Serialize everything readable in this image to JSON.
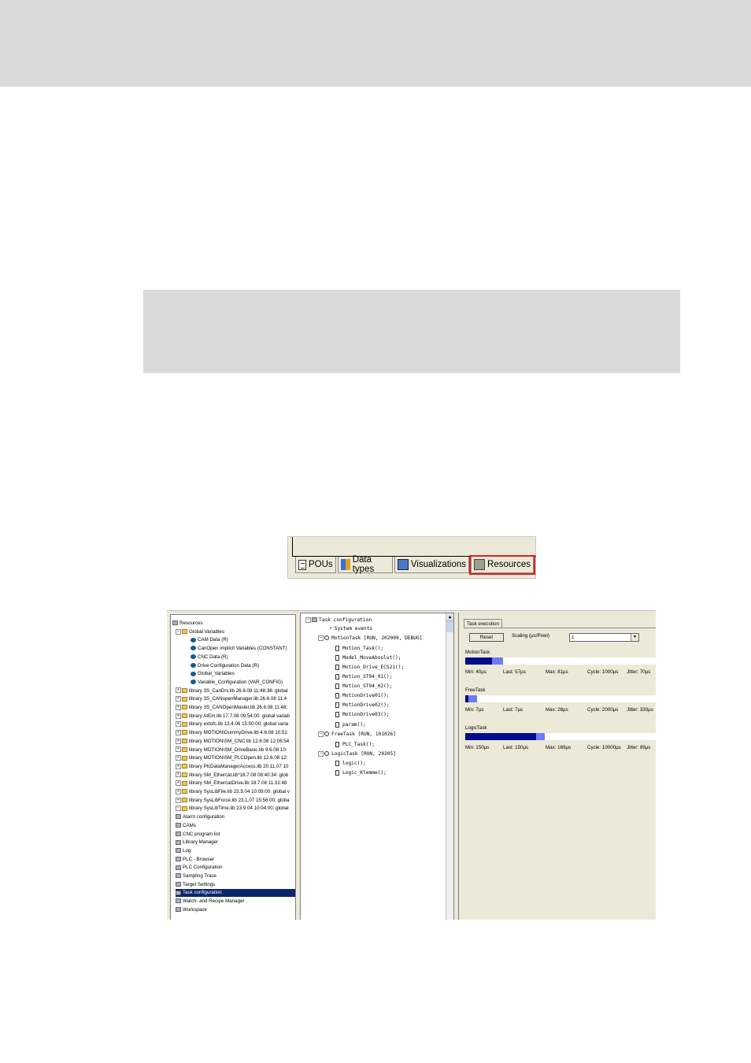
{
  "tabstrip": {
    "tabs": [
      {
        "label": "POUs",
        "icon": "document-icon"
      },
      {
        "label": "Data types",
        "icon": "data-types-icon"
      },
      {
        "label": "Visualizations",
        "icon": "visualization-icon"
      },
      {
        "label": "Resources",
        "icon": "resources-icon",
        "selected": true,
        "highlight_color": "#e02020"
      }
    ]
  },
  "left_tree": {
    "items": [
      {
        "label": "Resources",
        "icon": "resources-icon"
      },
      {
        "label": "Global Variables",
        "icon": "folder-icon"
      },
      {
        "label": "CAM Data (R)",
        "icon": "globe-icon"
      },
      {
        "label": "CanOpen implicit Variables (CONSTANT)",
        "icon": "globe-icon"
      },
      {
        "label": "CNC Data (R)",
        "icon": "globe-icon"
      },
      {
        "label": "Drive Configuration Data (R)",
        "icon": "globe-icon"
      },
      {
        "label": "Global_Variables",
        "icon": "globe-icon"
      },
      {
        "label": "Variable_Configuration (VAR_CONFIG)",
        "icon": "globe-icon"
      },
      {
        "label": "library 3S_CanDrv.lib 26.6.08 11:48:36: global",
        "icon": "folder-icon"
      },
      {
        "label": "library 3S_CANopenManager.lib 26.6.08 11:4",
        "icon": "folder-icon"
      },
      {
        "label": "library 3S_CANOpenMaster.lib 26.6.08 11:48:",
        "icon": "folder-icon"
      },
      {
        "label": "library AtEm.lib 17.7.08 09:54:00: global variab",
        "icon": "folder-icon"
      },
      {
        "label": "library extofc.lib 13.4.06 15:50:00: global varia",
        "icon": "folder-icon"
      },
      {
        "label": "library MOTION\\DummyDrive.lib 4.6.08 10:51:",
        "icon": "folder-icon"
      },
      {
        "label": "library MOTION\\SM_CNC.lib 12.6.08 12:06:54",
        "icon": "folder-icon"
      },
      {
        "label": "library MOTION\\SM_DriveBasic.lib 9.6.08 10:",
        "icon": "folder-icon"
      },
      {
        "label": "library MOTION\\SM_PLCOpen.lib 12.6.08 12:",
        "icon": "folder-icon"
      },
      {
        "label": "library PlcDataManagerAccess.lib 20.11.07 10",
        "icon": "folder-icon"
      },
      {
        "label": "library SM_Ethercat.lib*18.7.08 08:40:34: glob",
        "icon": "folder-icon"
      },
      {
        "label": "library SM_EthercatDrive.lib 18.7.08 11:31:48",
        "icon": "folder-icon"
      },
      {
        "label": "library SysLibFile.lib 23.9.04 10:09:00: global v",
        "icon": "folder-icon"
      },
      {
        "label": "library SysLibForce.lib 23.1.07 15:56:00: globa",
        "icon": "folder-icon"
      },
      {
        "label": "library SysLibTime.lib 23.9.04 10:04:00: global",
        "icon": "folder-icon"
      },
      {
        "label": "Alarm configuration",
        "icon": "alarm-icon"
      },
      {
        "label": "CAMs",
        "icon": "cam-icon"
      },
      {
        "label": "CNC program list",
        "icon": "cnc-icon"
      },
      {
        "label": "Library Manager",
        "icon": "library-icon"
      },
      {
        "label": "Log",
        "icon": "log-icon"
      },
      {
        "label": "PLC - Browser",
        "icon": "browser-icon"
      },
      {
        "label": "PLC Configuration",
        "icon": "plc-config-icon"
      },
      {
        "label": "Sampling Trace",
        "icon": "trace-icon"
      },
      {
        "label": "Target Settings",
        "icon": "target-icon"
      },
      {
        "label": "Task configuration",
        "icon": "task-config-icon",
        "selected": true
      },
      {
        "label": "Watch- and Recipe Manager",
        "icon": "watch-icon"
      },
      {
        "label": "Workspace",
        "icon": "workspace-icon"
      }
    ]
  },
  "mid_tree": {
    "items": [
      {
        "label": "Task configuration",
        "icon": "task-config-icon"
      },
      {
        "label": "System events",
        "icon": "lightning-icon"
      },
      {
        "label": "MotionTask [RUN, 202009, DEBUG]",
        "icon": "clock-icon"
      },
      {
        "label": "Motion_Task();",
        "icon": "page-icon"
      },
      {
        "label": "Model_MoveAbsolut();",
        "icon": "page-icon"
      },
      {
        "label": "Motion_Drive_ECS21();",
        "icon": "page-icon"
      },
      {
        "label": "Motion_ST94_01();",
        "icon": "page-icon"
      },
      {
        "label": "Motion_ST94_02();",
        "icon": "page-icon"
      },
      {
        "label": "MotionDrive01();",
        "icon": "page-icon"
      },
      {
        "label": "MotionDrive02();",
        "icon": "page-icon"
      },
      {
        "label": "MotionDrive03();",
        "icon": "page-icon"
      },
      {
        "label": "param();",
        "icon": "page-icon"
      },
      {
        "label": "FreeTask [RUN, 101026]",
        "icon": "clock-icon"
      },
      {
        "label": "PLC_Task();",
        "icon": "page-icon"
      },
      {
        "label": "LogicTask [RUN, 20205]",
        "icon": "clock-icon"
      },
      {
        "label": "logic();",
        "icon": "page-icon"
      },
      {
        "label": "Logic_Klemme();",
        "icon": "page-icon"
      }
    ]
  },
  "task_execution": {
    "tab_label": "Task execution",
    "reset_label": "Reset",
    "scaling_label": "Scaling (µs/Pixel)",
    "scaling_value": "1",
    "dropdown_arrow": "▼",
    "colors": {
      "bar_min": "#000c8c",
      "bar_extra": "#6d7cf2",
      "track": "#ffffff"
    },
    "tasks": [
      {
        "name": "MotionTask",
        "min": "Min: 40µs",
        "last": "Last: 57µs",
        "max": "Max: 81µs",
        "cycle": "Cycle: 1000µs",
        "jitter": "Jitter: 70µs",
        "last_us": 34,
        "max_us": 48
      },
      {
        "name": "FreeTask",
        "min": "Min: 7µs",
        "last": "Last: 7µs",
        "max": "Max: 26µs",
        "cycle": "Cycle: 2000µs",
        "jitter": "Jitter: 330µs",
        "last_us": 4,
        "max_us": 15
      },
      {
        "name": "LogicTask",
        "min": "Min: 150µs",
        "last": "Last: 150µs",
        "max": "Max: 169µs",
        "cycle": "Cycle: 10000µs",
        "jitter": "Jitter: 89µs",
        "last_us": 90,
        "max_us": 101
      }
    ]
  }
}
